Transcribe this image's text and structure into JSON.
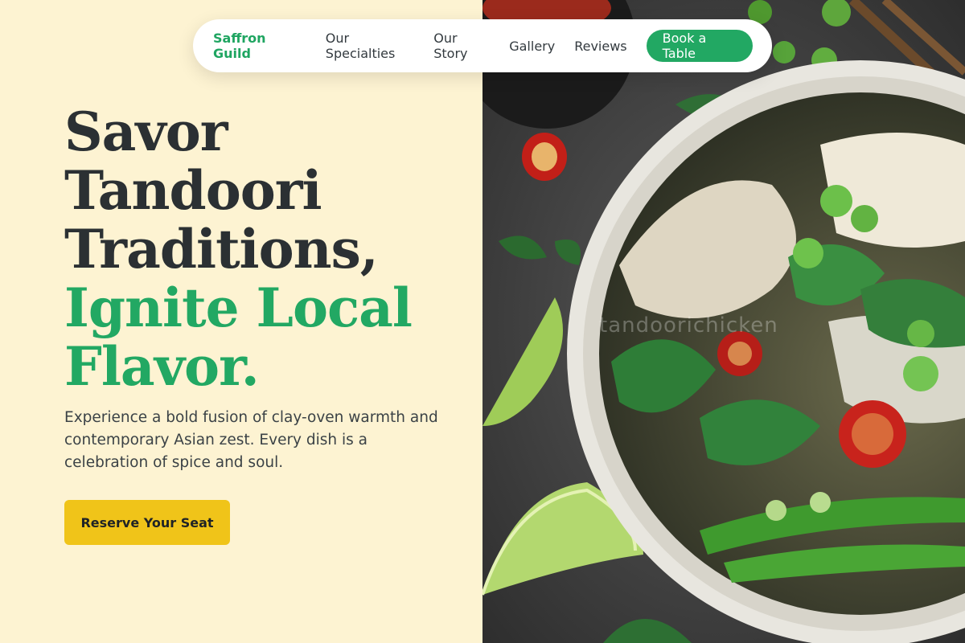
{
  "nav": {
    "brand": "Saffron Guild",
    "links": [
      "Our Specialties",
      "Our Story",
      "Gallery",
      "Reviews"
    ],
    "cta": "Book a Table"
  },
  "hero": {
    "line1": "Savor",
    "line2": "Tandoori",
    "line3": "Traditions,",
    "accent1": "Ignite Local",
    "accent2": "Flavor.",
    "subtitle": "Experience a bold fusion of clay-oven warmth and contemporary Asian zest. Every dish is a celebration of spice and soul.",
    "cta": "Reserve Your Seat"
  },
  "image": {
    "watermark": "tandoorichicken",
    "description_icon": "noodle-bowl-photo"
  },
  "colors": {
    "background": "#fdf3d2",
    "accent": "#22a863",
    "heading": "#2b3033",
    "cta": "#f0c419"
  }
}
